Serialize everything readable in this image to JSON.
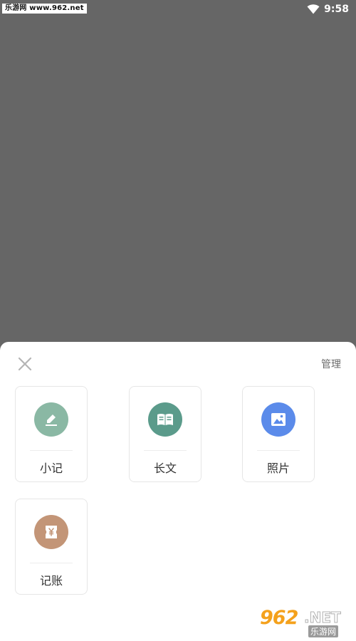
{
  "status_bar": {
    "watermark": "乐游网 www.962.net",
    "time": "9:58"
  },
  "sheet": {
    "manage_label": "管理",
    "items": [
      {
        "label": "小记",
        "icon": "pencil-icon",
        "color": "#8ab8a4"
      },
      {
        "label": "长文",
        "icon": "book-icon",
        "color": "#5b9b8b"
      },
      {
        "label": "照片",
        "icon": "image-icon",
        "color": "#5b8bea"
      },
      {
        "label": "记账",
        "icon": "receipt-yen-icon",
        "color": "#c39577"
      }
    ]
  },
  "watermark": {
    "brand": "962",
    "net": ".NET",
    "cn": "乐游网"
  }
}
